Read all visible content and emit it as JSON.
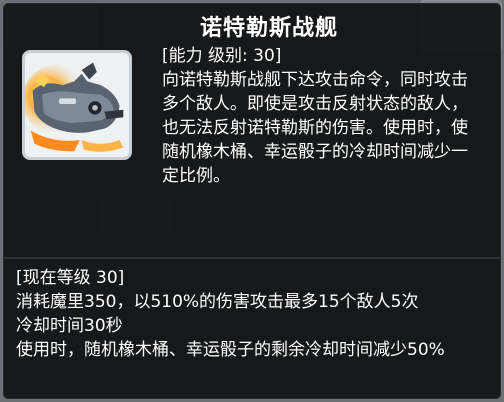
{
  "skill": {
    "name": "诺特勒斯战舰",
    "icon": "battleship-skill-icon",
    "level_line": "[能力 级别: 30]",
    "description": "向诺特勒斯战舰下达攻击命令，同时攻击多个敌人。即使是攻击反射状态的敌人，也无法反射诺特勒斯的伤害。使用时，使随机橡木桶、幸运骰子的冷却时间减少一定比例。"
  },
  "current_level": {
    "header": "[现在等级 30]",
    "lines": [
      "消耗魔里350，以510%的伤害攻击最多15个敌人5次",
      "冷却时间30秒",
      "使用时，随机橡木桶、幸运骰子的剩余冷却时间减少50%"
    ]
  },
  "colors": {
    "tooltip_bg": "#08090b",
    "text": "#ffffff"
  }
}
